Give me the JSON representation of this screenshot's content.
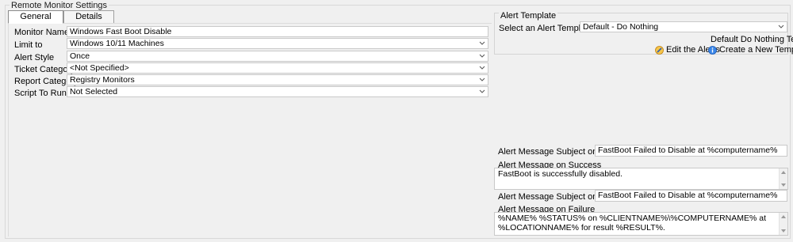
{
  "group_title": "Remote Monitor Settings",
  "tabs": [
    {
      "label": "General",
      "active": true
    },
    {
      "label": "Details",
      "active": false
    }
  ],
  "form": {
    "monitor_name": {
      "label": "Monitor Name",
      "value": "Windows Fast Boot Disable"
    },
    "limit_to": {
      "label": "Limit to",
      "value": "Windows 10/11 Machines"
    },
    "alert_style": {
      "label": "Alert Style",
      "value": "Once"
    },
    "ticket_category": {
      "label": "Ticket Category",
      "value": "<Not Specified>"
    },
    "report_category": {
      "label": "Report Category",
      "value": "Registry Monitors"
    },
    "script_to_run": {
      "label": "Script To Run",
      "value": "Not Selected"
    }
  },
  "alert_template": {
    "title": "Alert Template",
    "select_label": "Select an Alert Template",
    "select_value": "Default - Do Nothing",
    "description": "Default Do Nothing Template",
    "edit_label": "Edit the Alerts",
    "create_label": "Create a New Template"
  },
  "messages": {
    "success_subject_label": "Alert Message Subject on Success:",
    "success_subject_value": "FastBoot Failed to Disable at %computername%",
    "success_message_label": "Alert Message on Success",
    "success_message_value": "FastBoot is successfully disabled.",
    "failure_subject_label": "Alert Message Subject on Failure:",
    "failure_subject_value": "FastBoot Failed to Disable at %computername%",
    "failure_message_label": "Alert Message on Failure",
    "failure_message_value": "%NAME% %STATUS% on %CLIENTNAME%\\%COMPUTERNAME% at %LOCATIONNAME% for result %RESULT%."
  },
  "colors": {
    "background": "#f0f0f0",
    "field_border": "#c9c9c9",
    "edit_icon": "#e8a020",
    "create_icon": "#2a74d8"
  }
}
